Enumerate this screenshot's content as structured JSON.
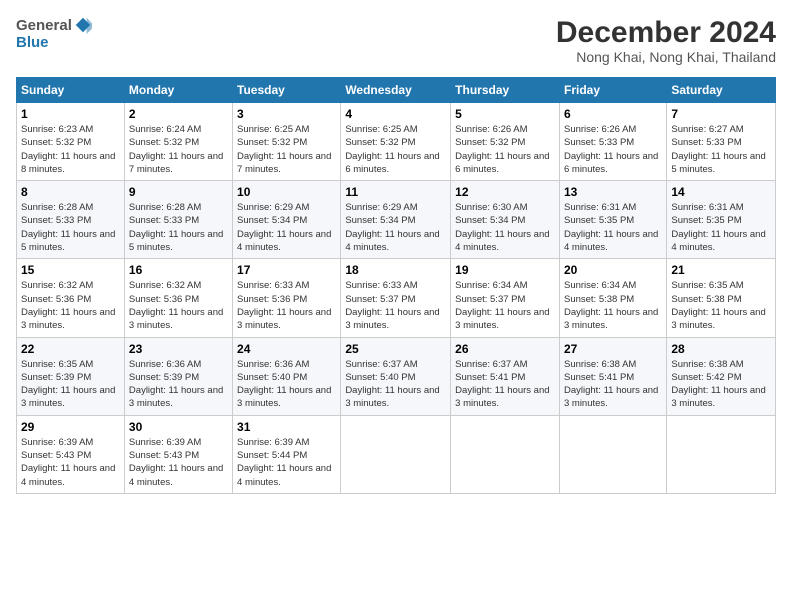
{
  "logo": {
    "general": "General",
    "blue": "Blue"
  },
  "title": {
    "month": "December 2024",
    "location": "Nong Khai, Nong Khai, Thailand"
  },
  "headers": [
    "Sunday",
    "Monday",
    "Tuesday",
    "Wednesday",
    "Thursday",
    "Friday",
    "Saturday"
  ],
  "weeks": [
    [
      {
        "day": "1",
        "sunrise": "6:23 AM",
        "sunset": "5:32 PM",
        "daylight": "11 hours and 8 minutes."
      },
      {
        "day": "2",
        "sunrise": "6:24 AM",
        "sunset": "5:32 PM",
        "daylight": "11 hours and 7 minutes."
      },
      {
        "day": "3",
        "sunrise": "6:25 AM",
        "sunset": "5:32 PM",
        "daylight": "11 hours and 7 minutes."
      },
      {
        "day": "4",
        "sunrise": "6:25 AM",
        "sunset": "5:32 PM",
        "daylight": "11 hours and 6 minutes."
      },
      {
        "day": "5",
        "sunrise": "6:26 AM",
        "sunset": "5:32 PM",
        "daylight": "11 hours and 6 minutes."
      },
      {
        "day": "6",
        "sunrise": "6:26 AM",
        "sunset": "5:33 PM",
        "daylight": "11 hours and 6 minutes."
      },
      {
        "day": "7",
        "sunrise": "6:27 AM",
        "sunset": "5:33 PM",
        "daylight": "11 hours and 5 minutes."
      }
    ],
    [
      {
        "day": "8",
        "sunrise": "6:28 AM",
        "sunset": "5:33 PM",
        "daylight": "11 hours and 5 minutes."
      },
      {
        "day": "9",
        "sunrise": "6:28 AM",
        "sunset": "5:33 PM",
        "daylight": "11 hours and 5 minutes."
      },
      {
        "day": "10",
        "sunrise": "6:29 AM",
        "sunset": "5:34 PM",
        "daylight": "11 hours and 4 minutes."
      },
      {
        "day": "11",
        "sunrise": "6:29 AM",
        "sunset": "5:34 PM",
        "daylight": "11 hours and 4 minutes."
      },
      {
        "day": "12",
        "sunrise": "6:30 AM",
        "sunset": "5:34 PM",
        "daylight": "11 hours and 4 minutes."
      },
      {
        "day": "13",
        "sunrise": "6:31 AM",
        "sunset": "5:35 PM",
        "daylight": "11 hours and 4 minutes."
      },
      {
        "day": "14",
        "sunrise": "6:31 AM",
        "sunset": "5:35 PM",
        "daylight": "11 hours and 4 minutes."
      }
    ],
    [
      {
        "day": "15",
        "sunrise": "6:32 AM",
        "sunset": "5:36 PM",
        "daylight": "11 hours and 3 minutes."
      },
      {
        "day": "16",
        "sunrise": "6:32 AM",
        "sunset": "5:36 PM",
        "daylight": "11 hours and 3 minutes."
      },
      {
        "day": "17",
        "sunrise": "6:33 AM",
        "sunset": "5:36 PM",
        "daylight": "11 hours and 3 minutes."
      },
      {
        "day": "18",
        "sunrise": "6:33 AM",
        "sunset": "5:37 PM",
        "daylight": "11 hours and 3 minutes."
      },
      {
        "day": "19",
        "sunrise": "6:34 AM",
        "sunset": "5:37 PM",
        "daylight": "11 hours and 3 minutes."
      },
      {
        "day": "20",
        "sunrise": "6:34 AM",
        "sunset": "5:38 PM",
        "daylight": "11 hours and 3 minutes."
      },
      {
        "day": "21",
        "sunrise": "6:35 AM",
        "sunset": "5:38 PM",
        "daylight": "11 hours and 3 minutes."
      }
    ],
    [
      {
        "day": "22",
        "sunrise": "6:35 AM",
        "sunset": "5:39 PM",
        "daylight": "11 hours and 3 minutes."
      },
      {
        "day": "23",
        "sunrise": "6:36 AM",
        "sunset": "5:39 PM",
        "daylight": "11 hours and 3 minutes."
      },
      {
        "day": "24",
        "sunrise": "6:36 AM",
        "sunset": "5:40 PM",
        "daylight": "11 hours and 3 minutes."
      },
      {
        "day": "25",
        "sunrise": "6:37 AM",
        "sunset": "5:40 PM",
        "daylight": "11 hours and 3 minutes."
      },
      {
        "day": "26",
        "sunrise": "6:37 AM",
        "sunset": "5:41 PM",
        "daylight": "11 hours and 3 minutes."
      },
      {
        "day": "27",
        "sunrise": "6:38 AM",
        "sunset": "5:41 PM",
        "daylight": "11 hours and 3 minutes."
      },
      {
        "day": "28",
        "sunrise": "6:38 AM",
        "sunset": "5:42 PM",
        "daylight": "11 hours and 3 minutes."
      }
    ],
    [
      {
        "day": "29",
        "sunrise": "6:39 AM",
        "sunset": "5:43 PM",
        "daylight": "11 hours and 4 minutes."
      },
      {
        "day": "30",
        "sunrise": "6:39 AM",
        "sunset": "5:43 PM",
        "daylight": "11 hours and 4 minutes."
      },
      {
        "day": "31",
        "sunrise": "6:39 AM",
        "sunset": "5:44 PM",
        "daylight": "11 hours and 4 minutes."
      },
      null,
      null,
      null,
      null
    ]
  ]
}
